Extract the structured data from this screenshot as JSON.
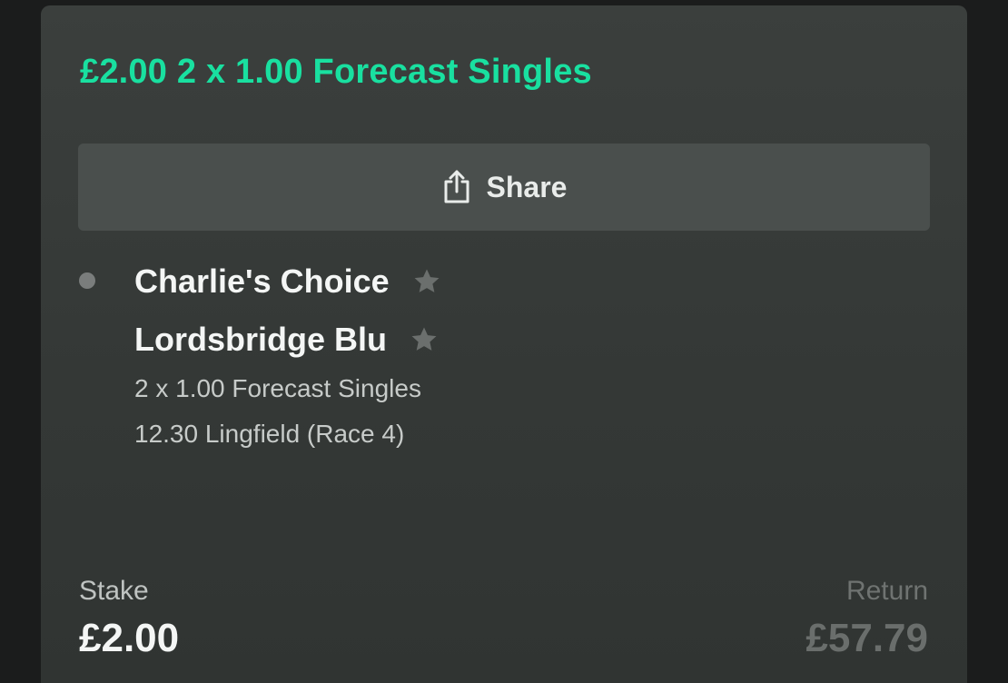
{
  "bet": {
    "title": "£2.00 2 x 1.00 Forecast Singles",
    "accent_color": "#19e0a0"
  },
  "share": {
    "label": "Share",
    "icon": "share-icon"
  },
  "selections": [
    {
      "name": "Charlie's Choice",
      "icon": "star-icon"
    },
    {
      "name": "Lordsbridge Blu",
      "icon": "star-icon"
    }
  ],
  "details": {
    "bet_type": "2 x 1.00 Forecast Singles",
    "event": "12.30 Lingfield (Race 4)"
  },
  "summary": {
    "stake_label": "Stake",
    "stake_value": "£2.00",
    "return_label": "Return",
    "return_value": "£57.79"
  }
}
